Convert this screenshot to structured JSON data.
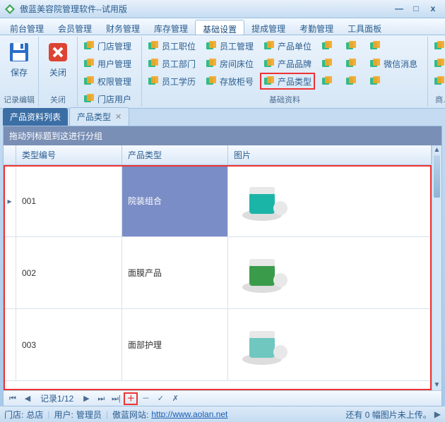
{
  "title": "傲蓝美容院管理软件--试用版",
  "winbtns": {
    "min": "—",
    "max": "□",
    "close": "x"
  },
  "menu": {
    "items": [
      "前台管理",
      "会员管理",
      "财务管理",
      "库存管理",
      "基础设置",
      "提成管理",
      "考勤管理",
      "工具面板"
    ],
    "active_index": 4
  },
  "ribbon": {
    "groups": [
      {
        "label": "记录编辑",
        "big": [
          {
            "name": "save",
            "text": "保存",
            "color": "#2a6dc9"
          }
        ]
      },
      {
        "label": "关闭",
        "big": [
          {
            "name": "close",
            "text": "关闭",
            "color": "#d43"
          }
        ]
      },
      {
        "label": "",
        "cols": [
          [
            "门店管理",
            "用户管理",
            "权限管理",
            "门店用户"
          ]
        ]
      },
      {
        "label": "基础资料",
        "cols": [
          [
            "员工职位",
            "员工部门",
            "员工学历"
          ],
          [
            "员工管理",
            "房间床位",
            "存放柜号"
          ],
          [
            "产品单位",
            "产品品牌",
            "产品类型"
          ],
          [
            "",
            "",
            ""
          ],
          [
            "",
            "",
            ""
          ],
          [
            "",
            "微信消息",
            ""
          ]
        ],
        "highlight": [
          2,
          2
        ]
      },
      {
        "label": "商…",
        "cols": [
          [
            "",
            "",
            ""
          ]
        ]
      }
    ]
  },
  "tabs": [
    {
      "label": "产品资料列表",
      "active": true
    },
    {
      "label": "产品类型",
      "active": false,
      "closable": true
    }
  ],
  "grid": {
    "group_hint": "拖动列标题到这进行分组",
    "columns": [
      "类型编号",
      "产品类型",
      "图片"
    ],
    "rows": [
      {
        "id": "001",
        "type": "院装组合",
        "img_color": "#1bb5a8",
        "selected": true
      },
      {
        "id": "002",
        "type": "面膜产品",
        "img_color": "#3a9b4a",
        "selected": false
      },
      {
        "id": "003",
        "type": "面部护理",
        "img_color": "#6fc7c0",
        "selected": false
      }
    ]
  },
  "navigator": {
    "record_label": "记录1/12",
    "buttons": [
      "⏮",
      "◀",
      "",
      "▶",
      "⏭",
      "⏭|",
      "＋",
      "－",
      "✓",
      "✗"
    ]
  },
  "status": {
    "store_label": "门店:",
    "store": "总店",
    "user_label": "用户:",
    "user": "管理员",
    "site_label": "傲蓝网站:",
    "site_url": "http://www.aolan.net",
    "right_text": "还有 0 幅图片未上传。"
  }
}
